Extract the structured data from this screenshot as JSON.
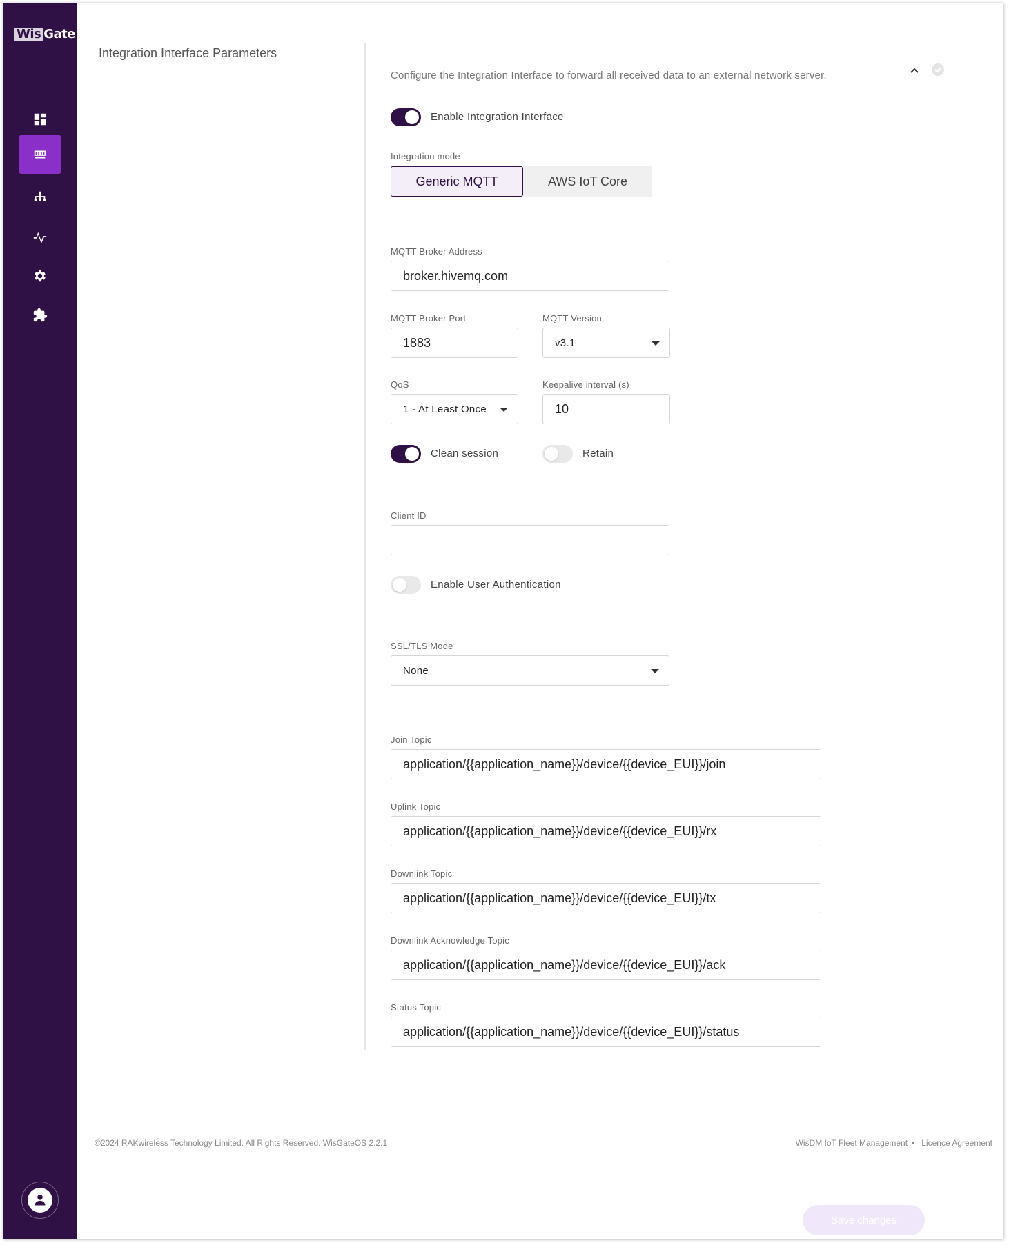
{
  "app": {
    "logo_wis": "Wis",
    "logo_gate": "Gate"
  },
  "sidebar": {
    "items": [
      {
        "name": "dashboard",
        "icon": "dashboard-icon"
      },
      {
        "name": "gateway",
        "icon": "gateway-icon",
        "active": true
      },
      {
        "name": "network",
        "icon": "network-icon"
      },
      {
        "name": "activity",
        "icon": "activity-icon"
      },
      {
        "name": "settings",
        "icon": "gear-icon"
      },
      {
        "name": "extensions",
        "icon": "puzzle-icon"
      }
    ],
    "user_icon": "user-icon"
  },
  "section": {
    "title": "Integration Interface Parameters",
    "description": "Configure the Integration Interface to forward all received data to an external network server."
  },
  "form": {
    "enable_integration": {
      "label": "Enable Integration Interface",
      "on": true
    },
    "integration_mode": {
      "label": "Integration mode",
      "options": [
        "Generic MQTT",
        "AWS IoT Core"
      ],
      "selected": "Generic MQTT"
    },
    "broker_address": {
      "label": "MQTT Broker Address",
      "value": "broker.hivemq.com"
    },
    "broker_port": {
      "label": "MQTT Broker Port",
      "value": "1883"
    },
    "mqtt_version": {
      "label": "MQTT Version",
      "value": "v3.1"
    },
    "qos": {
      "label": "QoS",
      "value": "1 - At Least Once"
    },
    "keepalive": {
      "label": "Keepalive interval (s)",
      "value": "10"
    },
    "clean_session": {
      "label": "Clean session",
      "on": true
    },
    "retain": {
      "label": "Retain",
      "on": false
    },
    "client_id": {
      "label": "Client ID",
      "value": ""
    },
    "user_auth": {
      "label": "Enable User Authentication",
      "on": false
    },
    "ssl_mode": {
      "label": "SSL/TLS Mode",
      "value": "None"
    },
    "join_topic": {
      "label": "Join Topic",
      "value": "application/{{application_name}}/device/{{device_EUI}}/join"
    },
    "uplink_topic": {
      "label": "Uplink Topic",
      "value": "application/{{application_name}}/device/{{device_EUI}}/rx"
    },
    "downlink_topic": {
      "label": "Downlink Topic",
      "value": "application/{{application_name}}/device/{{device_EUI}}/tx"
    },
    "downlink_ack_topic": {
      "label": "Downlink Acknowledge Topic",
      "value": "application/{{application_name}}/device/{{device_EUI}}/ack"
    },
    "status_topic": {
      "label": "Status Topic",
      "value": "application/{{application_name}}/device/{{device_EUI}}/status"
    }
  },
  "footer": {
    "copyright": "©2024 RAKwireless Technology Limited. All Rights Reserved. WisGateOS 2.2.1",
    "link1": "WisDM IoT Fleet Management",
    "separator": "•",
    "link2": "Licence Agreement"
  },
  "actions": {
    "save_label": "Save changes"
  },
  "colors": {
    "sidebar": "#2f1146",
    "accent": "#8a2fc7",
    "toggle_on": "#2f1146",
    "save_disabled": "#f1e7fa"
  }
}
